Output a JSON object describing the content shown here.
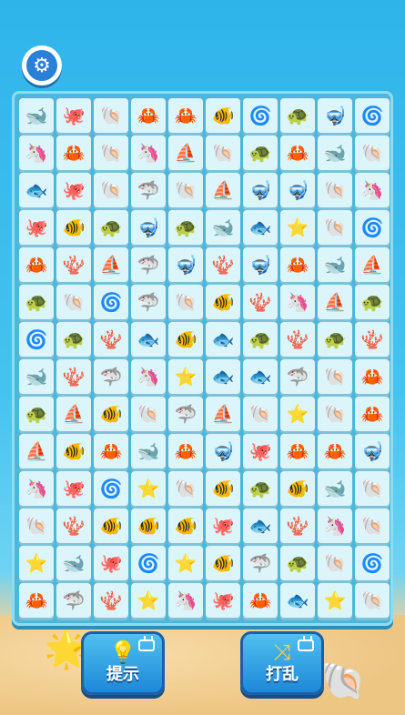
{
  "icons": {
    "whale": "🐋",
    "octopus": "🐙",
    "shell": "🐚",
    "crab": "🦀",
    "fish": "🐠",
    "snail": "🌀",
    "turtle": "🐢",
    "snorkel": "🤿",
    "seahorse": "🦄",
    "boat": "⛵",
    "shark": "🦈",
    "bluefish": "🐟",
    "coral": "🪸",
    "star": "⭐"
  },
  "board": [
    [
      "whale",
      "octopus",
      "shell",
      "crab",
      "crab",
      "fish",
      "snail",
      "turtle",
      "snorkel",
      "snail"
    ],
    [
      "seahorse",
      "crab",
      "shell",
      "seahorse",
      "boat",
      "shell",
      "turtle",
      "crab",
      "whale",
      "shell"
    ],
    [
      "bluefish",
      "octopus",
      "shell",
      "shark",
      "shell",
      "boat",
      "snorkel",
      "snorkel",
      "shell",
      "seahorse"
    ],
    [
      "octopus",
      "fish",
      "turtle",
      "snorkel",
      "turtle",
      "whale",
      "bluefish",
      "star",
      "shell",
      "snail"
    ],
    [
      "crab",
      "coral",
      "boat",
      "shark",
      "snorkel",
      "coral",
      "snorkel",
      "crab",
      "whale",
      "boat"
    ],
    [
      "turtle",
      "shell",
      "snail",
      "shark",
      "shell",
      "fish",
      "coral",
      "seahorse",
      "boat",
      "turtle"
    ],
    [
      "snail",
      "turtle",
      "coral",
      "bluefish",
      "fish",
      "bluefish",
      "turtle",
      "coral",
      "turtle",
      "coral"
    ],
    [
      "whale",
      "coral",
      "shark",
      "seahorse",
      "star",
      "bluefish",
      "bluefish",
      "shark",
      "shell",
      "crab"
    ],
    [
      "turtle",
      "boat",
      "fish",
      "shell",
      "shark",
      "boat",
      "shell",
      "star",
      "shell",
      "crab"
    ],
    [
      "boat",
      "fish",
      "crab",
      "whale",
      "crab",
      "snorkel",
      "octopus",
      "crab",
      "crab",
      "snorkel"
    ],
    [
      "seahorse",
      "octopus",
      "snail",
      "star",
      "shell",
      "fish",
      "turtle",
      "fish",
      "whale",
      "shell"
    ],
    [
      "shell",
      "coral",
      "fish",
      "fish",
      "fish",
      "octopus",
      "bluefish",
      "coral",
      "seahorse",
      "shell"
    ],
    [
      "star",
      "whale",
      "octopus",
      "snail",
      "star",
      "fish",
      "shark",
      "turtle",
      "shell",
      "snail"
    ],
    [
      "crab",
      "shark",
      "coral",
      "star",
      "seahorse",
      "octopus",
      "crab",
      "bluefish",
      "star",
      "shell"
    ]
  ],
  "settings": {
    "icon": "gear-icon"
  },
  "buttons": {
    "hint": {
      "label": "提示",
      "icon": "lightbulb-icon"
    },
    "shuffle": {
      "label": "打乱",
      "icon": "shuffle-arrows-icon"
    }
  }
}
